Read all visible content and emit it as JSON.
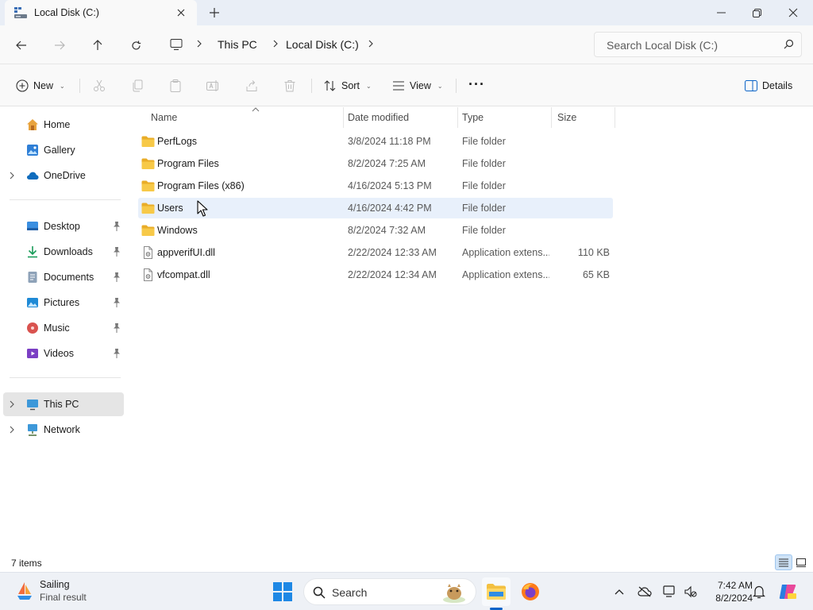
{
  "window": {
    "tab_title": "Local Disk (C:)",
    "new_tab_symbol": "+",
    "controls": [
      "minimize-icon",
      "restore-icon",
      "close-icon"
    ]
  },
  "address": {
    "breadcrumbs": [
      "This PC",
      "Local Disk (C:)"
    ],
    "search_placeholder": "Search Local Disk (C:)"
  },
  "toolbar": {
    "new_label": "New",
    "sort_label": "Sort",
    "view_label": "View",
    "more_label": "···",
    "details_label": "Details",
    "icons": [
      "cut-icon",
      "copy-icon",
      "paste-icon",
      "rename-icon",
      "share-icon",
      "delete-icon"
    ]
  },
  "sidebar": {
    "top": [
      {
        "label": "Home",
        "icon": "home-icon"
      },
      {
        "label": "Gallery",
        "icon": "gallery-icon"
      },
      {
        "label": "OneDrive",
        "icon": "onedrive-icon"
      }
    ],
    "quick": [
      {
        "label": "Desktop",
        "icon": "desktop-icon"
      },
      {
        "label": "Downloads",
        "icon": "downloads-icon"
      },
      {
        "label": "Documents",
        "icon": "documents-icon"
      },
      {
        "label": "Pictures",
        "icon": "pictures-icon"
      },
      {
        "label": "Music",
        "icon": "music-icon"
      },
      {
        "label": "Videos",
        "icon": "videos-icon"
      }
    ],
    "devices": [
      {
        "label": "This PC",
        "icon": "this-pc-icon"
      },
      {
        "label": "Network",
        "icon": "network-icon"
      }
    ]
  },
  "columns": {
    "name": "Name",
    "date": "Date modified",
    "type": "Type",
    "size": "Size"
  },
  "files": [
    {
      "name": "PerfLogs",
      "date": "3/8/2024 11:18 PM",
      "type": "File folder",
      "size": "",
      "kind": "folder"
    },
    {
      "name": "Program Files",
      "date": "8/2/2024 7:25 AM",
      "type": "File folder",
      "size": "",
      "kind": "folder"
    },
    {
      "name": "Program Files (x86)",
      "date": "4/16/2024 5:13 PM",
      "type": "File folder",
      "size": "",
      "kind": "folder"
    },
    {
      "name": "Users",
      "date": "4/16/2024 4:42 PM",
      "type": "File folder",
      "size": "",
      "kind": "folder"
    },
    {
      "name": "Windows",
      "date": "8/2/2024 7:32 AM",
      "type": "File folder",
      "size": "",
      "kind": "folder"
    },
    {
      "name": "appverifUI.dll",
      "date": "2/22/2024 12:33 AM",
      "type": "Application extens...",
      "size": "110 KB",
      "kind": "dll"
    },
    {
      "name": "vfcompat.dll",
      "date": "2/22/2024 12:34 AM",
      "type": "Application extens...",
      "size": "65 KB",
      "kind": "dll"
    }
  ],
  "status": {
    "item_count": "7 items"
  },
  "taskbar": {
    "weather_title": "Sailing",
    "weather_sub": "Final result",
    "search_placeholder": "Search",
    "time": "7:42 AM",
    "date": "8/2/2024"
  },
  "colors": {
    "accent": "#0a64c8",
    "folder": "#f3c041",
    "hover_row": "#e8f0fb",
    "selected_nav": "#e5e5e5"
  }
}
